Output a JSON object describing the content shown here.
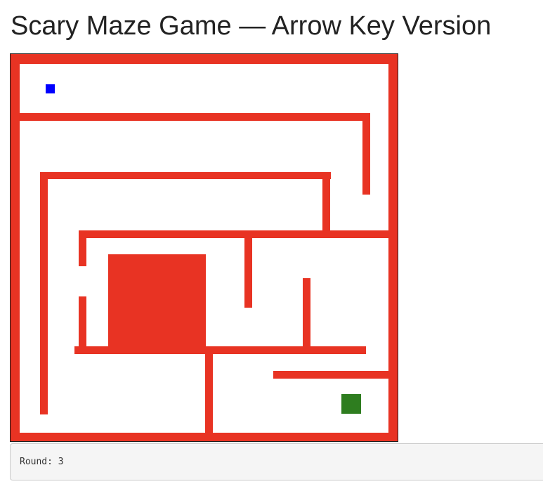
{
  "page": {
    "title": "Scary Maze Game — Arrow Key Version"
  },
  "game": {
    "colors": {
      "wall": "#e83323",
      "player": "#0000ff",
      "goal": "#2e7d1f",
      "background": "#ffffff"
    },
    "player_icon": "player-square-icon",
    "goal_icon": "goal-square-icon"
  },
  "status": {
    "text": "Round: 3"
  }
}
